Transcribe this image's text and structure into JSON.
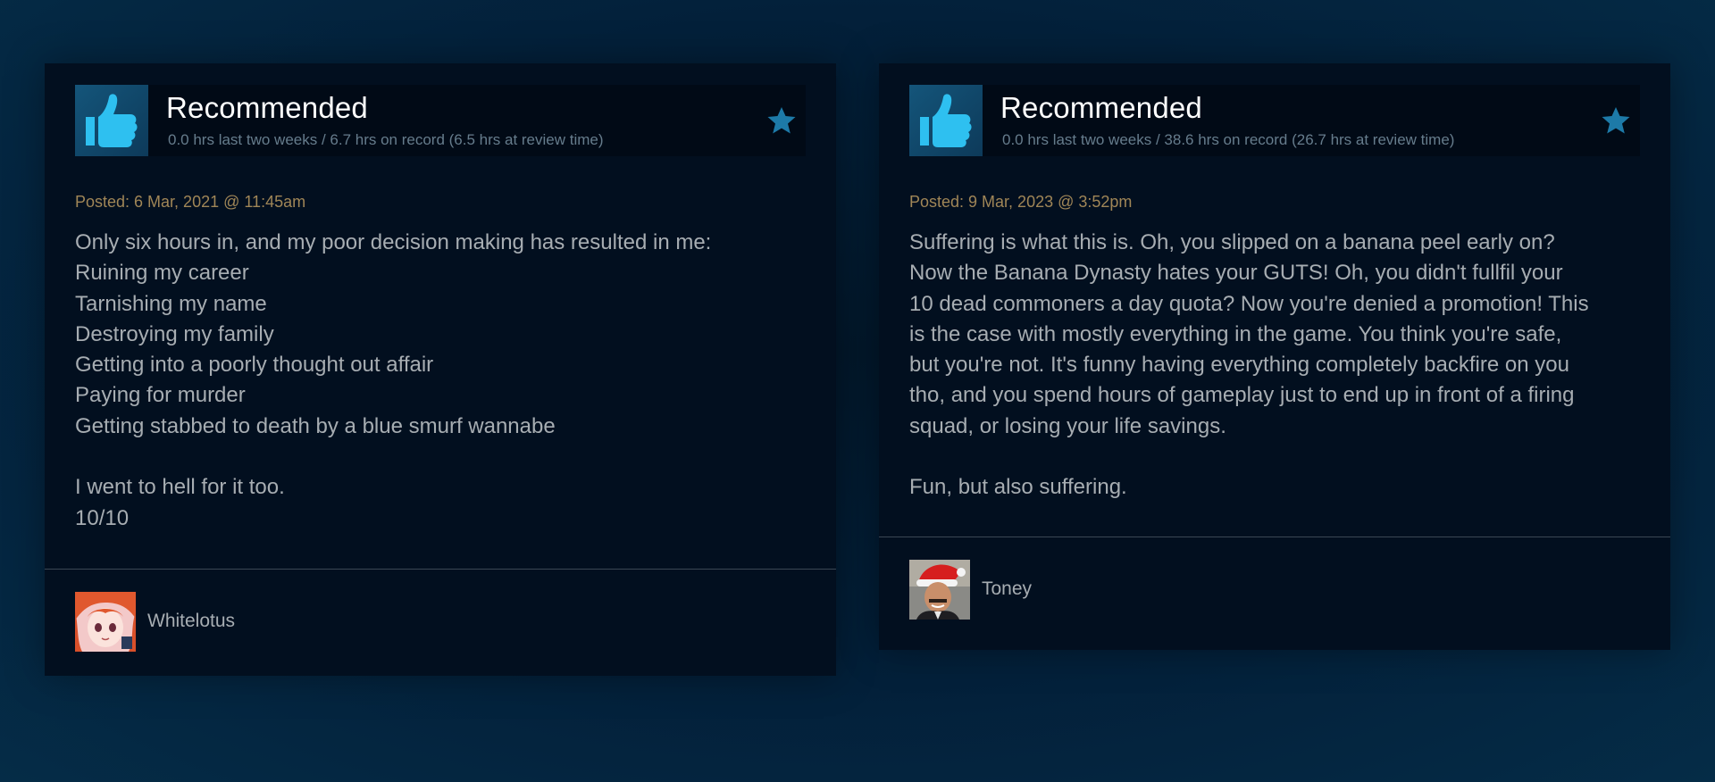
{
  "reviews": [
    {
      "verdict": "Recommended",
      "hours": "0.0 hrs last two weeks / 6.7 hrs on record (6.5 hrs at review time)",
      "posted": "Posted: 6 Mar, 2021 @ 11:45am",
      "lines": [
        "Only six hours in, and my poor decision making has resulted in me:",
        "Ruining my career",
        "Tarnishing my name",
        "Destroying my family",
        "Getting into a poorly thought out affair",
        "Paying for murder",
        "Getting stabbed to death by a blue smurf wannabe",
        "",
        "I went to hell for it too.",
        "10/10"
      ],
      "username": "Whitelotus",
      "avatar_icon": "anime-girl-avatar"
    },
    {
      "verdict": "Recommended",
      "hours": "0.0 hrs last two weeks / 38.6 hrs on record (26.7 hrs at review time)",
      "posted": "Posted: 9 Mar, 2023 @ 3:52pm",
      "lines": [
        "Suffering is what this is. Oh, you slipped on a banana peel early on?",
        "Now the Banana Dynasty hates your GUTS! Oh, you didn't fullfil your",
        "10 dead commoners a day quota? Now you're denied a promotion! This",
        "is the case with mostly everything in the game. You think you're safe,",
        "but you're not. It's funny having everything completely backfire on you",
        "tho, and you spend hours of gameplay just to end up in front of a firing",
        "squad, or losing your life savings.",
        "",
        "Fun, but also suffering."
      ],
      "username": "Toney",
      "avatar_icon": "santa-hat-man-avatar"
    }
  ],
  "colors": {
    "background": "#03203a",
    "card": "#020f1f",
    "header": "#010a16",
    "accent": "#2a9fd6",
    "posted": "#a08657",
    "text": "#a7adb2",
    "meta": "#667c8c"
  }
}
